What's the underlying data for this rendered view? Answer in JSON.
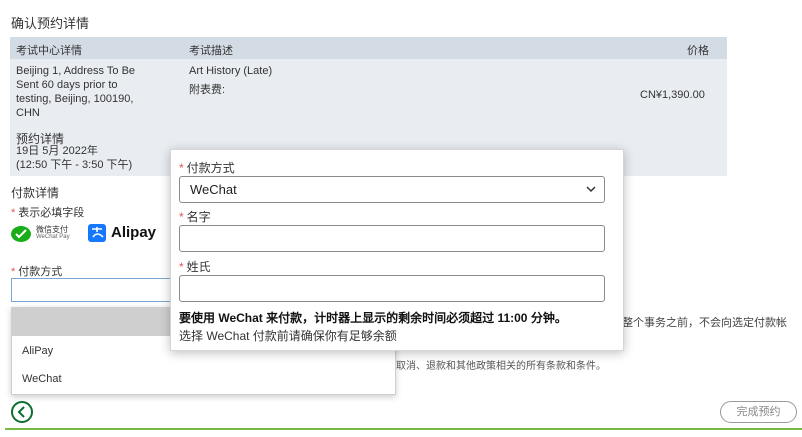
{
  "page": {
    "title": "确认预约详情"
  },
  "summary": {
    "headers": {
      "center": "考试中心详情",
      "description": "考试描述",
      "price": "价格"
    },
    "center_address": [
      "Beijing 1, Address To Be",
      "Sent 60 days prior to",
      "testing, Beijing, 100190,",
      "CHN"
    ],
    "exam_name": "Art History (Late)",
    "surcharge_label": "附表费:",
    "price": "CN¥1,390.00",
    "appointment_title": "预约详情",
    "appointment_date": "19日 5月 2022年",
    "appointment_time": "(12:50 下午 - 3:50 下午)"
  },
  "payment": {
    "title": "付款详情",
    "required_star": "*",
    "required_note": "表示必填字段",
    "wechat_logo_text": "微信支付",
    "wechat_logo_subtext": "WeChat Pay",
    "alipay_logo_text": "Alipay",
    "method_label": "付款方式",
    "dropdown_options": [
      "AliPay",
      "WeChat"
    ]
  },
  "policy": {
    "right_text": "整个事务之前，不会向选定付款帐",
    "bottom_text": "取消、退款和其他政策相关的所有条款和条件。"
  },
  "modal": {
    "method_label": "付款方式",
    "method_value": "WeChat",
    "first_name_label": "名字",
    "first_name_value": "",
    "last_name_label": "姓氏",
    "last_name_value": "",
    "warning_bold": "要使用 WeChat 来付款，计时器上显示的剩余时间必须超过 11:00 分钟。",
    "warning_sub": "选择 WeChat 付款前请确保你有足够余额"
  },
  "footer": {
    "complete_label": "完成预约"
  },
  "colors": {
    "accent_green": "#76b943",
    "back_green": "#0d6e2f",
    "required_red": "#e05555",
    "wechat": "#1aad19",
    "alipay": "#1677ff"
  }
}
